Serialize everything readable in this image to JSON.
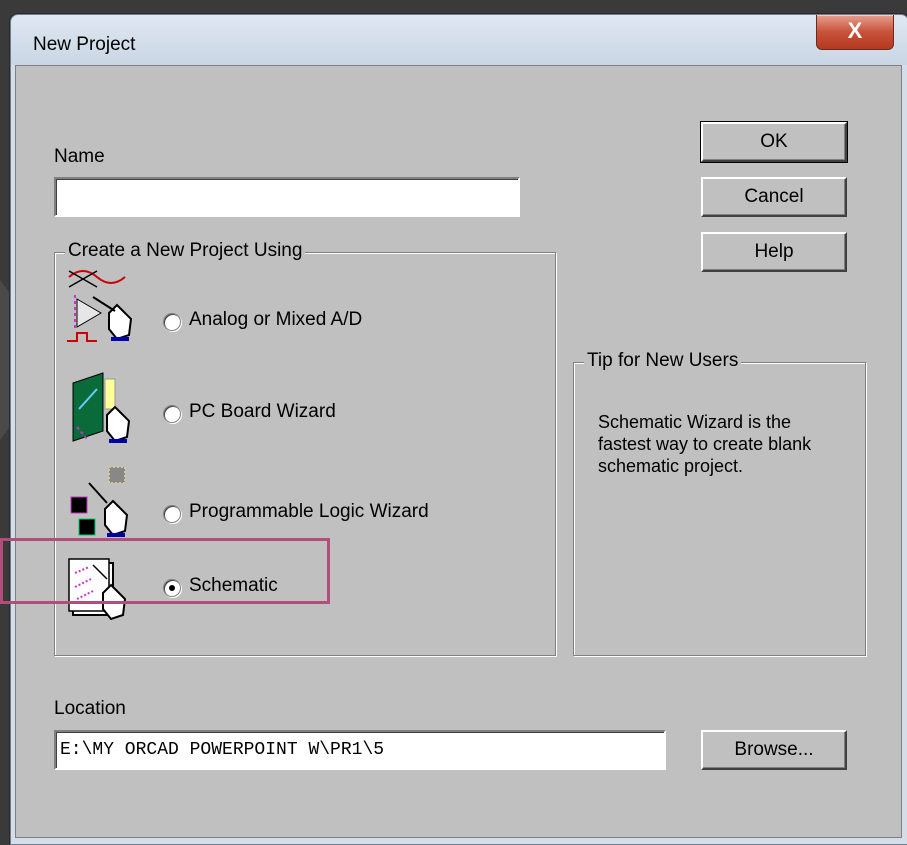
{
  "window": {
    "title": "New Project",
    "close_glyph": "X"
  },
  "name_field": {
    "label": "Name",
    "value": ""
  },
  "buttons": {
    "ok": "OK",
    "cancel": "Cancel",
    "help": "Help",
    "browse": "Browse..."
  },
  "project_group": {
    "legend": "Create a New Project Using",
    "options": [
      {
        "label": "Analog or Mixed A/D",
        "icon": "analog-mixed-icon",
        "checked": false
      },
      {
        "label": "PC Board Wizard",
        "icon": "pc-board-icon",
        "checked": false
      },
      {
        "label": "Programmable Logic Wizard",
        "icon": "programmable-logic-icon",
        "checked": false
      },
      {
        "label": "Schematic",
        "icon": "schematic-icon",
        "checked": true
      }
    ]
  },
  "tip_group": {
    "legend": "Tip for New Users",
    "lines": [
      "Schematic Wizard is the",
      "fastest way to create blank",
      "schematic project."
    ]
  },
  "location": {
    "label": "Location",
    "value": "E:\\MY ORCAD POWERPOINT W\\PR1\\5"
  },
  "colors": {
    "dialog_face": "#c0c0c0",
    "highlight": "#b0507a",
    "close_button": "#c8523a"
  }
}
